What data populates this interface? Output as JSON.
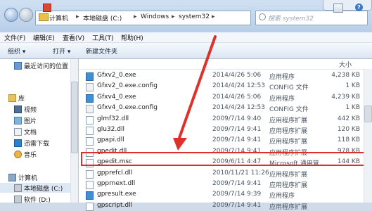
{
  "address": {
    "crumbs": [
      "计算机",
      "本地磁盘 (C:)",
      "Windows",
      "system32"
    ]
  },
  "search": {
    "placeholder": "搜索 system32"
  },
  "menu": [
    "文件(F)",
    "编辑(E)",
    "查看(V)",
    "工具(T)",
    "帮助(H)"
  ],
  "toolbar": {
    "organize": "组织 ▾",
    "open": "打开 ▾",
    "new_folder": "新建文件夹"
  },
  "nav": {
    "recent": "最近访问的位置",
    "library": "库",
    "video": "视频",
    "pictures": "图片",
    "documents": "文档",
    "thunder": "迅雷下载",
    "music": "音乐",
    "computer": "计算机",
    "local_disk": "本地磁盘 (C:)",
    "software": "软件 (D:)"
  },
  "columns": {
    "size": "大小"
  },
  "files": [
    {
      "name": "Gfxv2_0.exe",
      "date": "2014/4/26 5:06",
      "type": "应用程序",
      "size": "4,238 KB",
      "icon": "exe"
    },
    {
      "name": "Gfxv2_0.exe.config",
      "date": "2014/4/24 12:53",
      "type": "CONFIG 文件",
      "size": "1 KB",
      "icon": "cfg"
    },
    {
      "name": "Gfxv4_0.exe",
      "date": "2014/4/26 5:06",
      "type": "应用程序",
      "size": "4,239 KB",
      "icon": "exe"
    },
    {
      "name": "Gfxv4_0.exe.config",
      "date": "2014/4/24 12:53",
      "type": "CONFIG 文件",
      "size": "1 KB",
      "icon": "cfg"
    },
    {
      "name": "glmf32.dll",
      "date": "2009/7/14 9:40",
      "type": "应用程序扩展",
      "size": "442 KB",
      "icon": "dll"
    },
    {
      "name": "glu32.dll",
      "date": "2009/7/14 9:41",
      "type": "应用程序扩展",
      "size": "120 KB",
      "icon": "dll"
    },
    {
      "name": "gpapi.dll",
      "date": "2009/7/14 9:41",
      "type": "应用程序扩展",
      "size": "118 KB",
      "icon": "dll"
    },
    {
      "name": "gpedit.dll",
      "date": "2009/7/14 9:41",
      "type": "应用程序扩展",
      "size": "978 KB",
      "icon": "dll"
    },
    {
      "name": "gpedit.msc",
      "date": "2009/6/11 4:47",
      "type": "Microsoft 通用管...",
      "size": "144 KB",
      "icon": "msc"
    },
    {
      "name": "gpprefcl.dll",
      "date": "2010/11/21 11:26",
      "type": "应用程序扩展",
      "size": "",
      "icon": "dll"
    },
    {
      "name": "gpprnext.dll",
      "date": "2009/7/14 9:41",
      "type": "应用程序扩展",
      "size": "",
      "icon": "dll"
    },
    {
      "name": "gpresult.exe",
      "date": "2009/7/14 9:39",
      "type": "应用程序",
      "size": "",
      "icon": "exe"
    },
    {
      "name": "gpscript.dll",
      "date": "2009/7/14 9:41",
      "type": "应用程序扩展",
      "size": "",
      "icon": "dll"
    }
  ],
  "colors": {
    "highlight": "#d8302a",
    "arrow": "#e0302a",
    "chrome": "#cfdbe9"
  }
}
